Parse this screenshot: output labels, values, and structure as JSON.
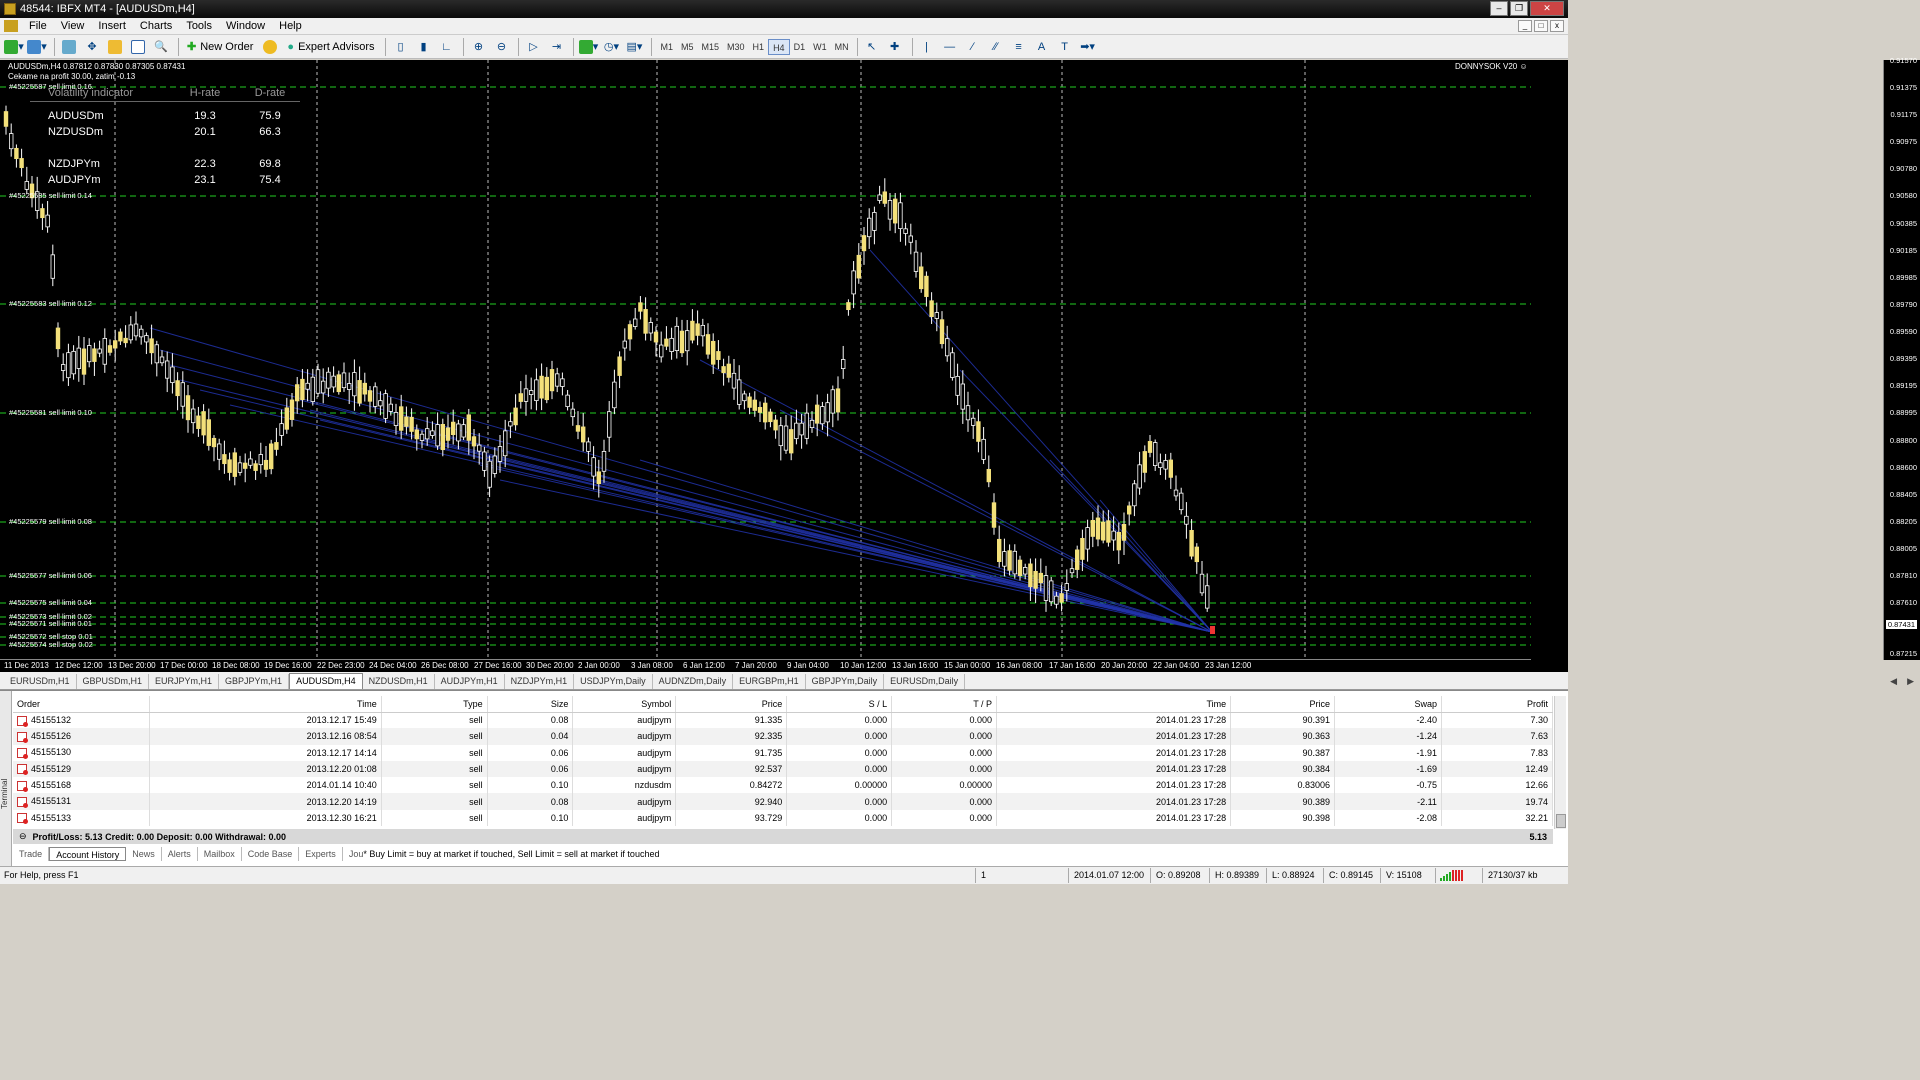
{
  "window": {
    "title": "48544: IBFX MT4 - [AUDUSDm,H4]"
  },
  "menu": [
    "File",
    "View",
    "Insert",
    "Charts",
    "Tools",
    "Window",
    "Help"
  ],
  "toolbar": {
    "new_order": "New Order",
    "expert_advisors": "Expert Advisors",
    "timeframes": [
      "M1",
      "M5",
      "M15",
      "M30",
      "H1",
      "H4",
      "D1",
      "W1",
      "MN"
    ],
    "active_timeframe": "H4"
  },
  "chart": {
    "header_line1": "AUDUSDm,H4  0.87812 0.87830 0.87305 0.87431",
    "header_line2": "Cekame na profit 30.00, zatim -0.13",
    "brand": "DONNYSOK V20",
    "current_price": "0.87431",
    "volatility": {
      "title": "Volatility indicator",
      "col_h": "H-rate",
      "col_d": "D-rate",
      "rows": [
        {
          "sym": "AUDUSDm",
          "h": "19.3",
          "d": "75.9"
        },
        {
          "sym": "NZDUSDm",
          "h": "20.1",
          "d": "66.3"
        },
        {
          "sym": "",
          "h": "",
          "d": ""
        },
        {
          "sym": "NZDJPYm",
          "h": "22.3",
          "d": "69.8"
        },
        {
          "sym": "AUDJPYm",
          "h": "23.1",
          "d": "75.4"
        }
      ]
    },
    "levels": [
      {
        "label": "#45225587 sell limit 0.16"
      },
      {
        "label": "#45225585 sell limit 0.14"
      },
      {
        "label": "#45225583 sell limit 0.12"
      },
      {
        "label": "#45225581 sell limit 0.10"
      },
      {
        "label": "#45225579 sell limit 0.08"
      },
      {
        "label": "#45225577 sell limit 0.06"
      },
      {
        "label": "#45225575 sell limit 0.04"
      },
      {
        "label": "#45225573 sell limit 0.02"
      },
      {
        "label": "#45225571 sell limit 0.01"
      },
      {
        "label": "#45225572 sell stop 0.01"
      },
      {
        "label": "#45225574 sell stop 0.02"
      }
    ],
    "y_ticks": [
      "0.91570",
      "0.91375",
      "0.91175",
      "0.90975",
      "0.90780",
      "0.90580",
      "0.90385",
      "0.90185",
      "0.89985",
      "0.89790",
      "0.89590",
      "0.89395",
      "0.89195",
      "0.88995",
      "0.88800",
      "0.88600",
      "0.88405",
      "0.88205",
      "0.88005",
      "0.87810",
      "0.87610",
      "0.87215"
    ],
    "x_ticks": [
      "11 Dec 2013",
      "12 Dec 12:00",
      "13 Dec 20:00",
      "17 Dec 00:00",
      "18 Dec 08:00",
      "19 Dec 16:00",
      "22 Dec 23:00",
      "24 Dec 04:00",
      "26 Dec 08:00",
      "27 Dec 16:00",
      "30 Dec 20:00",
      "2 Jan 00:00",
      "3 Jan 08:00",
      "6 Jan 12:00",
      "7 Jan 20:00",
      "9 Jan 04:00",
      "10 Jan 12:00",
      "13 Jan 16:00",
      "15 Jan 00:00",
      "16 Jan 08:00",
      "17 Jan 16:00",
      "20 Jan 20:00",
      "22 Jan 04:00",
      "23 Jan 12:00"
    ]
  },
  "chart_tabs": [
    "EURUSDm,H1",
    "GBPUSDm,H1",
    "EURJPYm,H1",
    "GBPJPYm,H1",
    "AUDUSDm,H4",
    "NZDUSDm,H1",
    "AUDJPYm,H1",
    "NZDJPYm,H1",
    "USDJPYm,Daily",
    "AUDNZDm,Daily",
    "EURGBPm,H1",
    "GBPJPYm,Daily",
    "EURUSDm,Daily"
  ],
  "active_chart_tab": "AUDUSDm,H4",
  "terminal": {
    "side_label": "Terminal",
    "columns": [
      "Order",
      "Time",
      "Type",
      "Size",
      "Symbol",
      "Price",
      "S / L",
      "T / P",
      "Time",
      "Price",
      "Swap",
      "Profit"
    ],
    "rows": [
      [
        "45155132",
        "2013.12.17 15:49",
        "sell",
        "0.08",
        "audjpym",
        "91.335",
        "0.000",
        "0.000",
        "2014.01.23 17:28",
        "90.391",
        "-2.40",
        "7.30"
      ],
      [
        "45155126",
        "2013.12.16 08:54",
        "sell",
        "0.04",
        "audjpym",
        "92.335",
        "0.000",
        "0.000",
        "2014.01.23 17:28",
        "90.363",
        "-1.24",
        "7.63"
      ],
      [
        "45155130",
        "2013.12.17 14:14",
        "sell",
        "0.06",
        "audjpym",
        "91.735",
        "0.000",
        "0.000",
        "2014.01.23 17:28",
        "90.387",
        "-1.91",
        "7.83"
      ],
      [
        "45155129",
        "2013.12.20 01:08",
        "sell",
        "0.06",
        "audjpym",
        "92.537",
        "0.000",
        "0.000",
        "2014.01.23 17:28",
        "90.384",
        "-1.69",
        "12.49"
      ],
      [
        "45155168",
        "2014.01.14 10:40",
        "sell",
        "0.10",
        "nzdusdm",
        "0.84272",
        "0.00000",
        "0.00000",
        "2014.01.23 17:28",
        "0.83006",
        "-0.75",
        "12.66"
      ],
      [
        "45155131",
        "2013.12.20 14:19",
        "sell",
        "0.08",
        "audjpym",
        "92.940",
        "0.000",
        "0.000",
        "2014.01.23 17:28",
        "90.389",
        "-2.11",
        "19.74"
      ],
      [
        "45155133",
        "2013.12.30 16:21",
        "sell",
        "0.10",
        "audjpym",
        "93.729",
        "0.000",
        "0.000",
        "2014.01.23 17:28",
        "90.398",
        "-2.08",
        "32.21"
      ]
    ],
    "summary": "Profit/Loss: 5.13  Credit: 0.00  Deposit: 0.00  Withdrawal: 0.00",
    "summary_total": "5.13",
    "tabs": [
      "Trade",
      "Account History",
      "News",
      "Alerts",
      "Mailbox",
      "Code Base",
      "Experts",
      "Jou"
    ],
    "active_tab": "Account History",
    "journal_msg": "* Buy Limit = buy at market if touched, Sell Limit = sell at market if touched"
  },
  "status": {
    "help": "For Help, press F1",
    "profile": "1",
    "datetime": "2014.01.07 12:00",
    "open": "O: 0.89208",
    "high": "H: 0.89389",
    "low": "L: 0.88924",
    "close": "C: 0.89145",
    "volume": "V: 15108",
    "traffic": "27130/37 kb"
  }
}
